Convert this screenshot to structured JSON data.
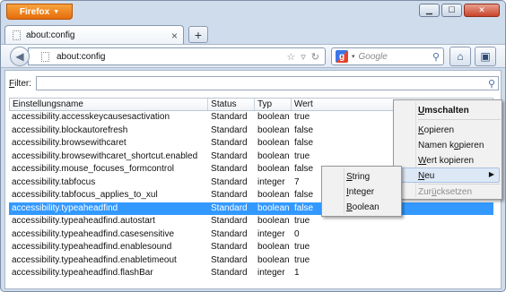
{
  "app": {
    "menu_button": "Firefox"
  },
  "window_controls": {
    "minimize": "▁",
    "maximize": "☐",
    "close": "✕"
  },
  "tab": {
    "title": "about:config",
    "close": "×",
    "new_tab": "+"
  },
  "navbar": {
    "url": "about:config",
    "search_placeholder": "Google"
  },
  "filter": {
    "label_prefix": "F",
    "label_rest": "ilter:",
    "value": ""
  },
  "table": {
    "headers": [
      "Einstellungsname",
      "Status",
      "Typ",
      "Wert"
    ],
    "rows": [
      {
        "name": "accessibility.accesskeycausesactivation",
        "status": "Standard",
        "type": "boolean",
        "value": "true"
      },
      {
        "name": "accessibility.blockautorefresh",
        "status": "Standard",
        "type": "boolean",
        "value": "false"
      },
      {
        "name": "accessibility.browsewithcaret",
        "status": "Standard",
        "type": "boolean",
        "value": "false"
      },
      {
        "name": "accessibility.browsewithcaret_shortcut.enabled",
        "status": "Standard",
        "type": "boolean",
        "value": "true"
      },
      {
        "name": "accessibility.mouse_focuses_formcontrol",
        "status": "Standard",
        "type": "boolean",
        "value": "false"
      },
      {
        "name": "accessibility.tabfocus",
        "status": "Standard",
        "type": "integer",
        "value": "7"
      },
      {
        "name": "accessibility.tabfocus_applies_to_xul",
        "status": "Standard",
        "type": "boolean",
        "value": "false"
      },
      {
        "name": "accessibility.typeaheadfind",
        "status": "Standard",
        "type": "boolean",
        "value": "false",
        "selected": true
      },
      {
        "name": "accessibility.typeaheadfind.autostart",
        "status": "Standard",
        "type": "boolean",
        "value": "true"
      },
      {
        "name": "accessibility.typeaheadfind.casesensitive",
        "status": "Standard",
        "type": "integer",
        "value": "0"
      },
      {
        "name": "accessibility.typeaheadfind.enablesound",
        "status": "Standard",
        "type": "boolean",
        "value": "true"
      },
      {
        "name": "accessibility.typeaheadfind.enabletimeout",
        "status": "Standard",
        "type": "boolean",
        "value": "true"
      },
      {
        "name": "accessibility.typeaheadfind.flashBar",
        "status": "Standard",
        "type": "integer",
        "value": "1"
      }
    ]
  },
  "context_menu": {
    "toggle": {
      "pre": "",
      "key": "U",
      "post": "mschalten"
    },
    "copy": {
      "pre": "",
      "key": "K",
      "post": "opieren"
    },
    "copy_name": {
      "pre": "Namen k",
      "key": "o",
      "post": "pieren"
    },
    "copy_value": {
      "pre": "",
      "key": "W",
      "post": "ert kopieren"
    },
    "new": {
      "pre": "",
      "key": "N",
      "post": "eu"
    },
    "reset": {
      "pre": "Zur",
      "key": "ü",
      "post": "cksetzen"
    }
  },
  "submenu": {
    "string": {
      "pre": "",
      "key": "S",
      "post": "tring"
    },
    "integer": {
      "pre": "",
      "key": "I",
      "post": "nteger"
    },
    "boolean": {
      "pre": "",
      "key": "B",
      "post": "oolean"
    }
  }
}
